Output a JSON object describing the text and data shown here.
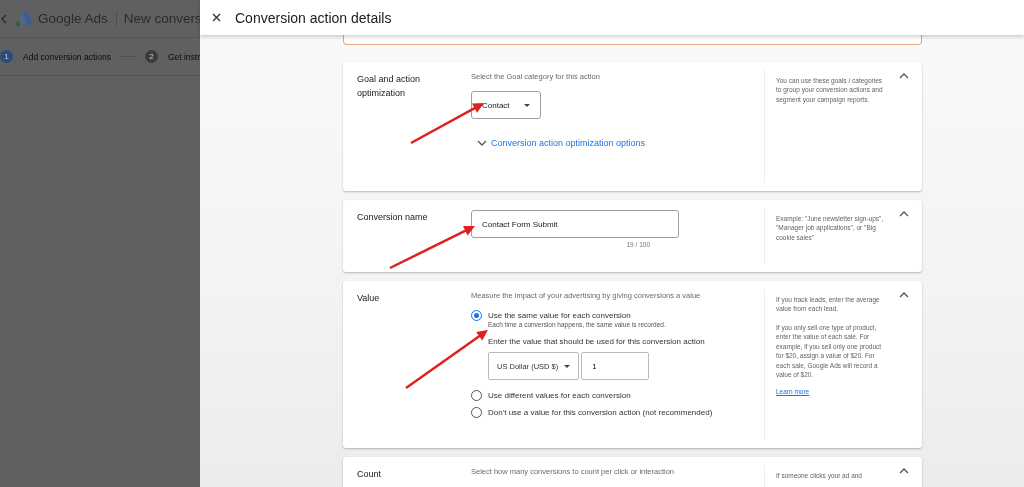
{
  "background": {
    "app_name": "Google Ads",
    "page_title": "New convers",
    "steps": [
      {
        "number": "1",
        "label": "Add conversion actions",
        "selected": true
      },
      {
        "number": "2",
        "label": "Get instr",
        "selected": false
      }
    ]
  },
  "panel": {
    "title": "Conversion action details",
    "sections": [
      {
        "kind": "select",
        "label": "Goal and action optimization",
        "description": "Select the Goal category for this action",
        "select_value": "Contact",
        "link": "Conversion action optimization options",
        "help": [
          "You can use these goals / categories to group your conversion actions and segment your campaign reports."
        ],
        "expanded": true
      },
      {
        "kind": "text",
        "label": "Conversion name",
        "input_value": "Contact Form Submit",
        "counter": "19 / 100",
        "help": [
          "Example: \"June newsletter sign-ups\", \"Manager job applications\", or \"Big cookie sales\""
        ],
        "expanded": true
      },
      {
        "kind": "value",
        "label": "Value",
        "description": "Measure the impact of your advertising by giving conversions a value",
        "options": [
          {
            "label": "Use the same value for each conversion",
            "hint": "Each time a conversion happens, the same value is recorded.",
            "selected": true
          },
          {
            "label": "Use different values for each conversion",
            "selected": false
          },
          {
            "label": "Don't use a value for this conversion action (not recommended)",
            "selected": false
          }
        ],
        "value_prompt": "Enter the value that should be used for this conversion action",
        "currency": "US Dollar (USD $)",
        "amount": "1",
        "help": [
          "If you track leads, enter the average value from each lead.",
          "If you only sell one type of product, enter the value of each sale. For example, if you sell only one product for $20, assign a value of $20. For each sale, Google Ads will record a value of $20."
        ],
        "help_link": "Learn more",
        "expanded": true
      },
      {
        "kind": "count",
        "label": "Count",
        "description": "Select how many conversions to count per click or interaction",
        "help": [
          "If someone clicks your ad and"
        ],
        "expanded": true
      }
    ]
  }
}
